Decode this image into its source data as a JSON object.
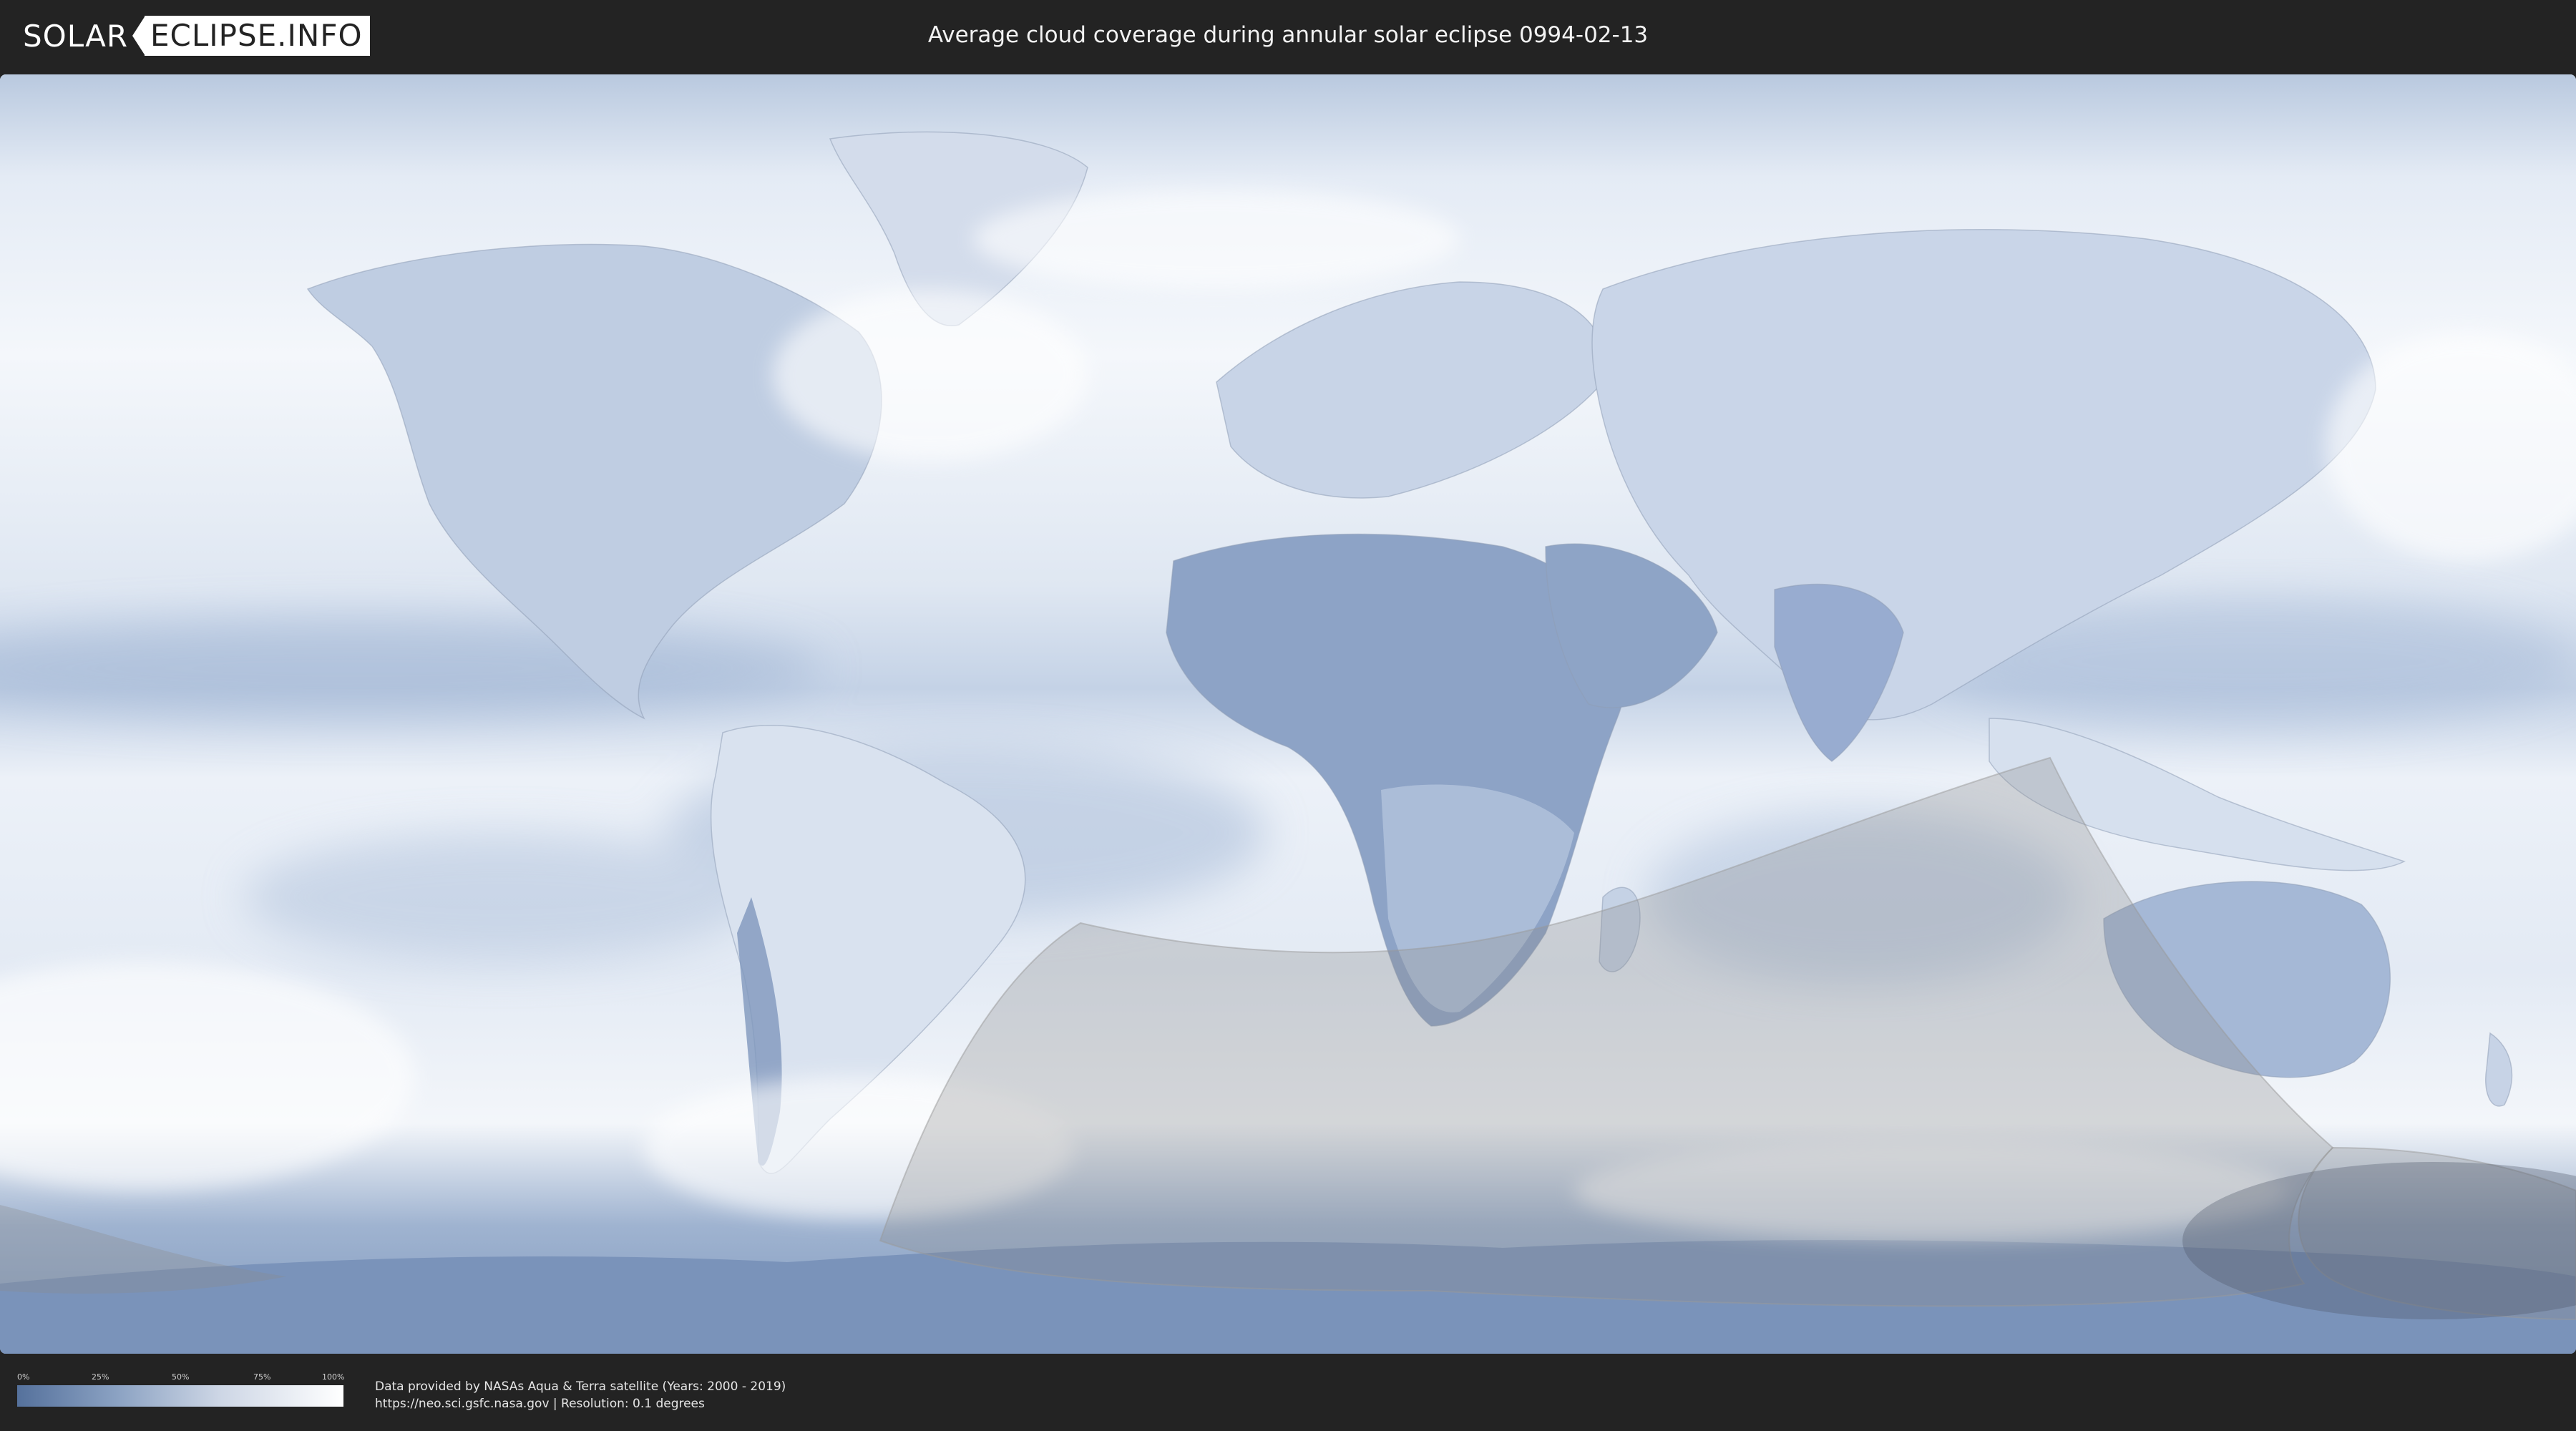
{
  "header": {
    "logo_left": "SOLAR",
    "logo_right": "ECLIPSE.INFO",
    "title": "Average cloud coverage during annular solar eclipse 0994-02-13"
  },
  "map": {
    "projection": "equirectangular world map",
    "base_layer": "average cloud coverage (blue = clear, white = cloudy)",
    "overlay": "eclipse visibility region (grey translucent)",
    "colors": {
      "clear": "#55719c",
      "cloudy": "#ffffff",
      "ocean_mid": "#c6d3e6",
      "eclipse_shade": "#808080"
    }
  },
  "legend": {
    "ticks": [
      "0%",
      "25%",
      "50%",
      "75%",
      "100%"
    ],
    "values": [
      0,
      25,
      50,
      75,
      100
    ],
    "color_low": "#55719c",
    "color_high": "#ffffff"
  },
  "footer": {
    "credit_line1": "Data provided by NASAs Aqua & Terra satellite (Years: 2000 - 2019)",
    "credit_line2": "https://neo.sci.gsfc.nasa.gov | Resolution: 0.1 degrees"
  }
}
